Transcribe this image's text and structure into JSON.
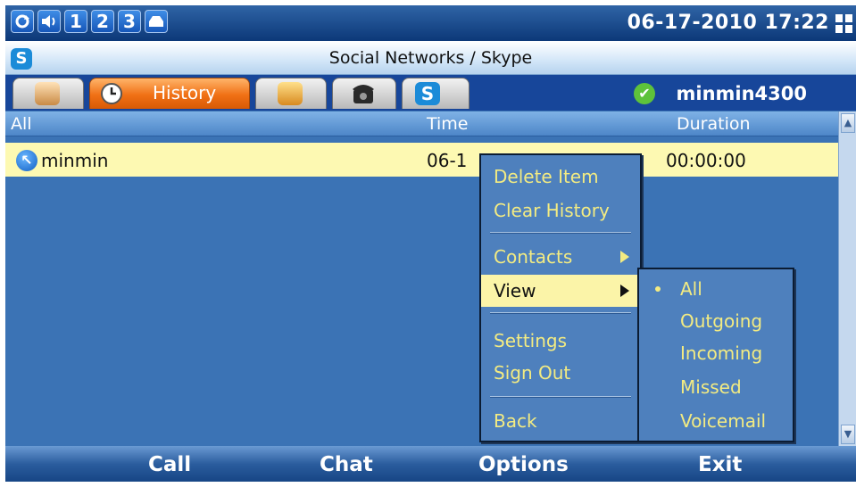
{
  "status_bar": {
    "icons": [
      "sync-icon",
      "volume-icon",
      "1",
      "2",
      "3",
      "inbox-icon"
    ],
    "datetime": "06-17-2010 17:22"
  },
  "title_bar": {
    "title": "Social Networks / Skype",
    "app_icon": "skype-icon"
  },
  "tabs": [
    {
      "name": "contacts",
      "icon": "contacts-icon",
      "label": ""
    },
    {
      "name": "history",
      "icon": "clock-icon",
      "label": "History",
      "active": true
    },
    {
      "name": "groups",
      "icon": "groups-icon",
      "label": ""
    },
    {
      "name": "dialpad",
      "icon": "phone-icon",
      "label": ""
    },
    {
      "name": "skype",
      "icon": "skype-icon",
      "label": ""
    }
  ],
  "account": {
    "status_icon": "online-check-icon",
    "username": "minmin4300",
    "status_color": "#5ec23b"
  },
  "list": {
    "columns": [
      "All",
      "Time",
      "Duration"
    ],
    "rows": [
      {
        "name": "minmin",
        "time": "06-1",
        "duration": "00:00:00",
        "icon": "outgoing-call-icon"
      }
    ]
  },
  "context_menu": {
    "items": [
      "Delete Item",
      "Clear History",
      "Contacts",
      "View",
      "Settings",
      "Sign Out",
      "Back"
    ],
    "selected": "View"
  },
  "view_submenu": {
    "items": [
      "All",
      "Outgoing",
      "Incoming",
      "Missed",
      "Voicemail"
    ],
    "checked": "All"
  },
  "softkeys": [
    "Call",
    "Chat",
    "Options",
    "Exit"
  ],
  "colors": {
    "background": "#3b73b5",
    "menu_text": "#f3eb82",
    "highlight": "#fbf4a8",
    "active_tab": "#f07015"
  }
}
